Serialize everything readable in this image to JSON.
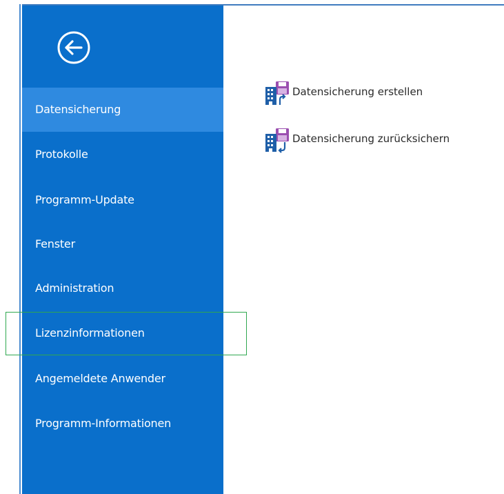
{
  "sidebar": {
    "back_icon": "arrow-left-circle-icon",
    "active_index": 0,
    "items": [
      {
        "label": "Datensicherung"
      },
      {
        "label": "Protokolle"
      },
      {
        "label": "Programm-Update"
      },
      {
        "label": "Fenster"
      },
      {
        "label": "Administration"
      },
      {
        "label": "Lizenzinformationen"
      },
      {
        "label": "Angemeldete Anwender"
      },
      {
        "label": "Programm-Informationen"
      }
    ]
  },
  "main": {
    "actions": [
      {
        "label": "Datensicherung erstellen",
        "icon": "backup-create-icon"
      },
      {
        "label": "Datensicherung zurücksichern",
        "icon": "backup-restore-icon"
      }
    ]
  },
  "colors": {
    "sidebar_bg": "#0a6fcb",
    "sidebar_active_bg": "#2f8ae0",
    "highlight_border": "#2fa84f",
    "icon_purple": "#9b4fb0",
    "icon_blue": "#1f5fa8"
  }
}
